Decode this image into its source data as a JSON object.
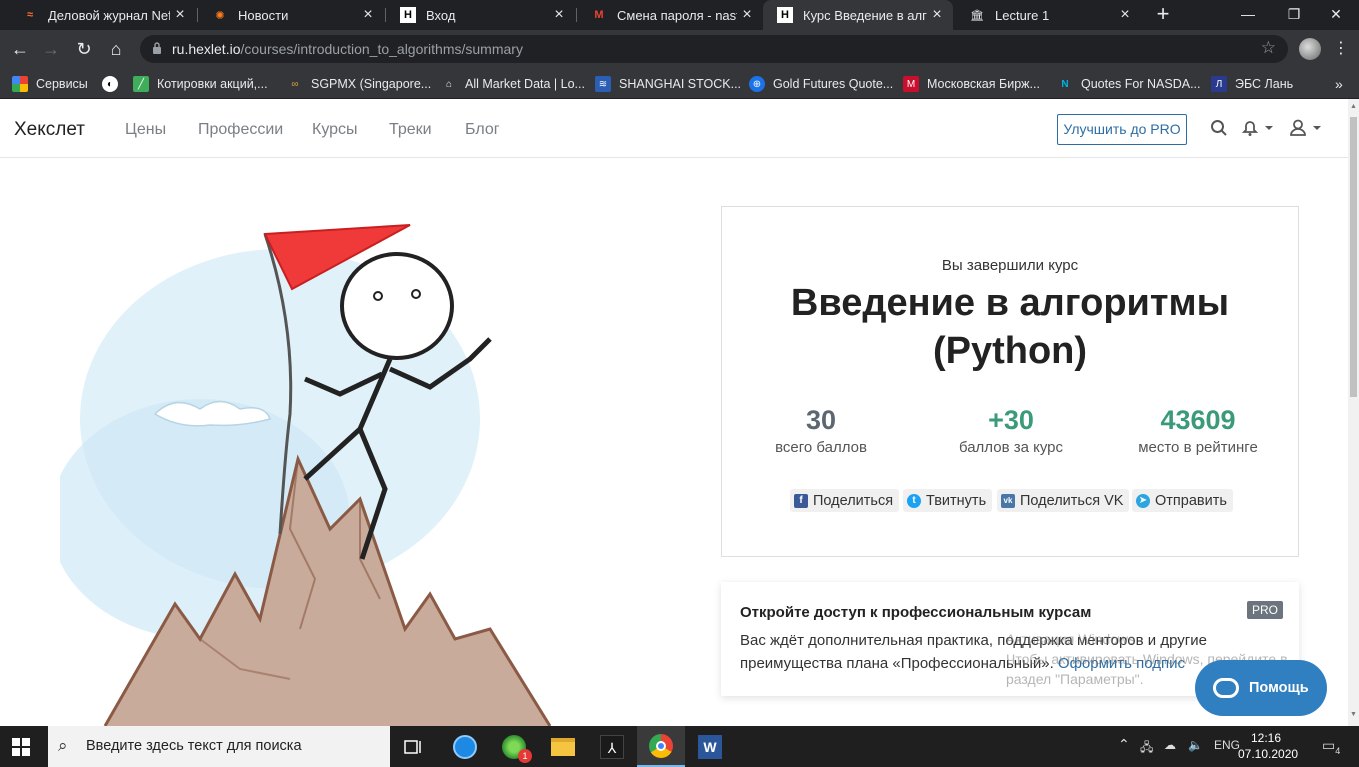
{
  "browser": {
    "tabs": [
      {
        "title": "Деловой журнал Nefte"
      },
      {
        "title": "Новости"
      },
      {
        "title": "Вход"
      },
      {
        "title": "Смена пароля - nastya"
      },
      {
        "title": "Курс Введение в алгор"
      },
      {
        "title": "Lecture 1"
      }
    ],
    "url_host": "ru.hexlet.io",
    "url_path": "/courses/introduction_to_algorithms/summary",
    "bookmarks": [
      {
        "label": "Сервисы"
      },
      {
        "label": "Котировки акций,..."
      },
      {
        "label": "SGPMX (Singapore..."
      },
      {
        "label": "All Market Data | Lo..."
      },
      {
        "label": "SHANGHAI STOCK..."
      },
      {
        "label": "Gold Futures Quote..."
      },
      {
        "label": "Московская Бирж..."
      },
      {
        "label": "Quotes For NASDA..."
      },
      {
        "label": "ЭБС Лань"
      }
    ]
  },
  "site": {
    "logo": "Хекслет",
    "nav": [
      "Цены",
      "Профессии",
      "Курсы",
      "Треки",
      "Блог"
    ],
    "upgrade_button": "Улучшить до PRO"
  },
  "summary": {
    "completed_text": "Вы завершили курс",
    "course_title": "Введение в алгоритмы (Python)",
    "stats": [
      {
        "value": "30",
        "label": "всего баллов",
        "color": "#5d6772"
      },
      {
        "value": "+30",
        "label": "баллов за курс",
        "color": "#3a9a7a"
      },
      {
        "value": "43609",
        "label": "место в рейтинге",
        "color": "#3a9a7a"
      }
    ],
    "share": [
      {
        "label": "Поделиться",
        "icon": "facebook-icon"
      },
      {
        "label": "Твитнуть",
        "icon": "twitter-icon"
      },
      {
        "label": "Поделиться VK",
        "icon": "vk-icon"
      },
      {
        "label": "Отправить",
        "icon": "telegram-icon"
      }
    ]
  },
  "pro_card": {
    "title": "Откройте доступ к профессиональным курсам",
    "badge": "PRO",
    "text_before": "Вас ждёт дополнительная практика, поддержка менторов и другие преимущества плана «Профессиональный».",
    "link": "Оформить подпис"
  },
  "watermark": {
    "line1": "Активация Windows",
    "line2": "Чтобы активировать Windows, перейдите в",
    "line3": "раздел \"Параметры\"."
  },
  "help_button": "Помощь",
  "taskbar": {
    "search_placeholder": "Введите здесь текст для поиска",
    "notif_badge": "1",
    "lang": "ENG",
    "time": "12:16",
    "date": "07.10.2020",
    "action_center_count": "4"
  }
}
